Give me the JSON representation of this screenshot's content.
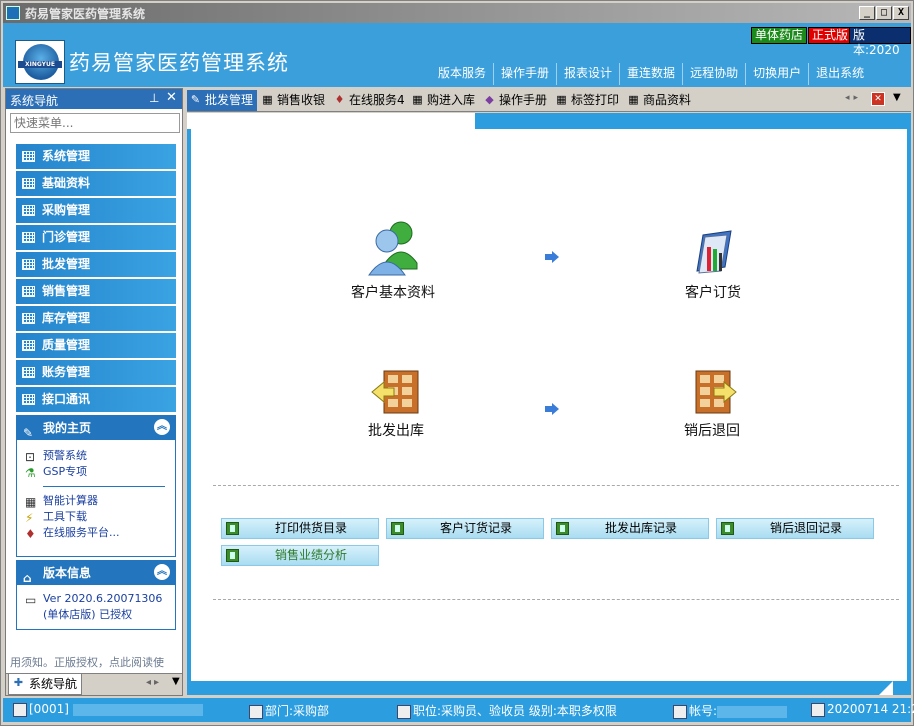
{
  "window": {
    "title": "药易管家医药管理系统",
    "caption_buttons": [
      "_",
      "□",
      "X"
    ]
  },
  "header": {
    "logo_text": "XINGYUE",
    "app_title": "药易管家医药管理系统",
    "badges": {
      "store": "单体药店",
      "license": "正式版",
      "version": "版本:2020"
    },
    "menu": [
      "版本服务",
      "操作手册",
      "报表设计",
      "重连数据",
      "远程协助",
      "切换用户",
      "退出系统"
    ]
  },
  "left_panel": {
    "title": "系统导航",
    "pin_icon": "pin-icon",
    "close_glyph": "✕",
    "search_placeholder": "快速菜单...",
    "nav_items": [
      "系统管理",
      "基础资料",
      "采购管理",
      "门诊管理",
      "批发管理",
      "销售管理",
      "库存管理",
      "质量管理",
      "账务管理",
      "接口通讯"
    ],
    "home_section": {
      "title": "我的主页",
      "links_top": [
        "预警系统",
        "GSP专项"
      ],
      "links_bottom": [
        "智能计算器",
        "工具下载",
        "在线服务平台..."
      ]
    },
    "version_section": {
      "title": "版本信息",
      "line1": "Ver 2020.6.20071306",
      "line2": "(单体店版) 已授权"
    },
    "notice": "用须知。正版授权，点此阅读使",
    "footer_tab": "系统导航"
  },
  "tabs": [
    {
      "label": "批发管理",
      "icon": "wand-icon",
      "active": true
    },
    {
      "label": "销售收银",
      "icon": "grid-icon",
      "active": false
    },
    {
      "label": "在线服务4",
      "icon": "service-icon",
      "active": false
    },
    {
      "label": "购进入库",
      "icon": "grid-icon",
      "active": false
    },
    {
      "label": "操作手册",
      "icon": "book-icon",
      "active": false
    },
    {
      "label": "标签打印",
      "icon": "grid-icon",
      "active": false
    },
    {
      "label": "商品资料",
      "icon": "grid-icon",
      "active": false
    }
  ],
  "flow": {
    "customer_info": "客户基本资料",
    "customer_order": "客户订货",
    "wholesale_out": "批发出库",
    "sales_return": "销后退回"
  },
  "reports": [
    "打印供货目录",
    "客户订货记录",
    "批发出库记录",
    "销后退回记录",
    "销售业绩分析"
  ],
  "status": {
    "code": "[0001]",
    "dept": "部门:采购部",
    "position": "职位:采购员、验收员 级别:本职多权限",
    "account": "帐号:",
    "date": "20200714 21:2"
  },
  "colors": {
    "accent": "#2c9ee0",
    "nav_item": "#2584cc",
    "active_tab": "#2d6fb6",
    "license_red": "#e00000",
    "store_green": "#1b8a1b"
  }
}
